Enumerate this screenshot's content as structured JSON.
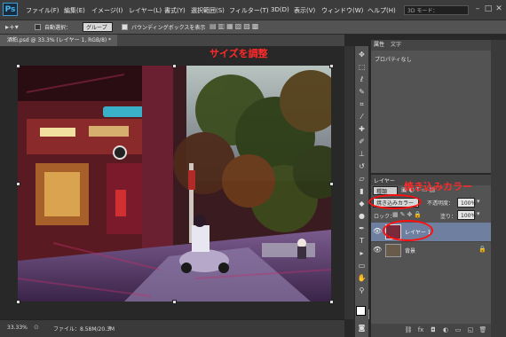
{
  "app": {
    "logo": "Ps"
  },
  "menu": [
    "ファイル(F)",
    "編集(E)",
    "イメージ(I)",
    "レイヤー(L)",
    "書式(Y)",
    "選択範囲(S)",
    "フィルター(T)",
    "3D(D)",
    "表示(V)",
    "ウィンドウ(W)",
    "ヘルプ(H)"
  ],
  "workspace_mode": "3D モード：",
  "options": {
    "auto_select_label": "自動選択：",
    "auto_select_value": "グループ",
    "bounding_box_label": "バウンディングボックスを表示"
  },
  "document": {
    "tab_title": "酒粕.psd @ 33.3% (レイヤー 1, RGB/8) *"
  },
  "status": {
    "zoom": "33.33%",
    "file_info": "ファイル：8.58M/20.3M"
  },
  "properties": {
    "tabs": [
      "属性",
      "文字"
    ],
    "empty_text": "プロパティなし"
  },
  "layers_panel": {
    "title": "レイヤー",
    "kind_filter": "種類",
    "blend_mode": "焼き込みカラー",
    "opacity_label": "不透明度：",
    "opacity_value": "100%",
    "lock_label": "ロック：",
    "fill_label": "塗り：",
    "fill_value": "100%",
    "layers": [
      {
        "name": "レイヤー 1",
        "selected": true
      },
      {
        "name": "背景",
        "selected": false
      }
    ]
  },
  "annotations": {
    "top": "サイズを調整",
    "right": "焼き込みカラー"
  },
  "colors": {
    "accent_red": "#ff2a2a",
    "ps_blue": "#47b5f0",
    "panel": "#535353"
  }
}
